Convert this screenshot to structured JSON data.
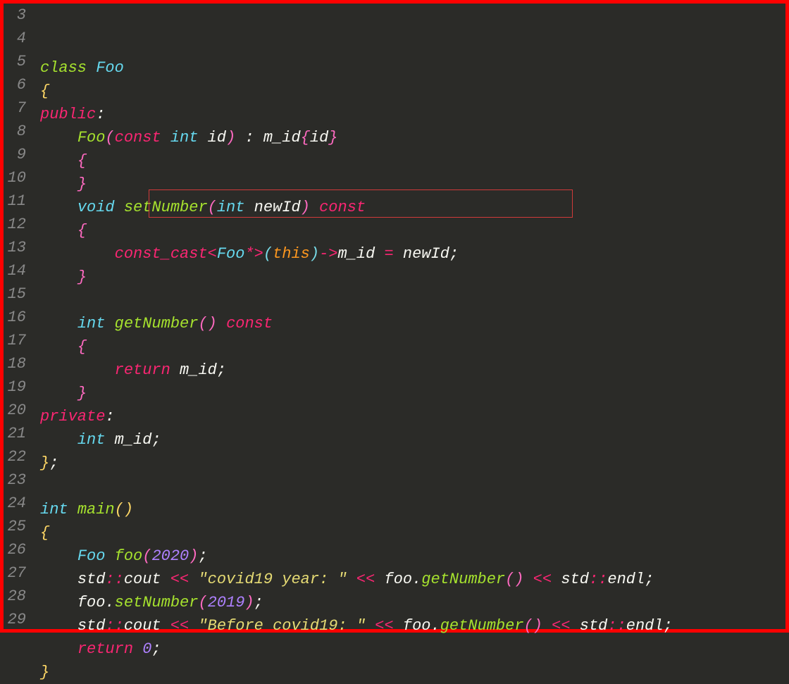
{
  "lines": [
    {
      "num": "3",
      "tokens": [
        [
          "kw-class",
          "class"
        ],
        [
          "punct",
          " "
        ],
        [
          "classname",
          "Foo"
        ]
      ]
    },
    {
      "num": "4",
      "tokens": [
        [
          "brace-y",
          "{"
        ]
      ]
    },
    {
      "num": "5",
      "tokens": [
        [
          "kw-access",
          "public"
        ],
        [
          "punct",
          ":"
        ]
      ]
    },
    {
      "num": "6",
      "tokens": [
        [
          "punct",
          "    "
        ],
        [
          "fn",
          "Foo"
        ],
        [
          "brace-p",
          "("
        ],
        [
          "kw-const",
          "const"
        ],
        [
          "punct",
          " "
        ],
        [
          "kw-type",
          "int"
        ],
        [
          "punct",
          " "
        ],
        [
          "ident",
          "id"
        ],
        [
          "brace-p",
          ")"
        ],
        [
          "punct",
          " : "
        ],
        [
          "ident",
          "m_id"
        ],
        [
          "brace-p",
          "{"
        ],
        [
          "ident",
          "id"
        ],
        [
          "brace-p",
          "}"
        ]
      ]
    },
    {
      "num": "7",
      "tokens": [
        [
          "punct",
          "    "
        ],
        [
          "brace-p",
          "{"
        ]
      ]
    },
    {
      "num": "8",
      "tokens": [
        [
          "punct",
          "    "
        ],
        [
          "brace-p",
          "}"
        ]
      ]
    },
    {
      "num": "9",
      "tokens": [
        [
          "punct",
          "    "
        ],
        [
          "kw-type",
          "void"
        ],
        [
          "punct",
          " "
        ],
        [
          "fn",
          "setNumber"
        ],
        [
          "brace-p",
          "("
        ],
        [
          "kw-type",
          "int"
        ],
        [
          "punct",
          " "
        ],
        [
          "ident",
          "newId"
        ],
        [
          "brace-p",
          ")"
        ],
        [
          "punct",
          " "
        ],
        [
          "kw-const",
          "const"
        ]
      ]
    },
    {
      "num": "10",
      "tokens": [
        [
          "punct",
          "    "
        ],
        [
          "brace-p",
          "{"
        ]
      ]
    },
    {
      "num": "11",
      "tokens": [
        [
          "punct",
          "        "
        ],
        [
          "kw-cast",
          "const_cast"
        ],
        [
          "op",
          "<"
        ],
        [
          "classname",
          "Foo"
        ],
        [
          "op",
          "*>"
        ],
        [
          "brace-b",
          "("
        ],
        [
          "kw-this",
          "this"
        ],
        [
          "brace-b",
          ")"
        ],
        [
          "op",
          "->"
        ],
        [
          "ident",
          "m_id "
        ],
        [
          "op",
          "="
        ],
        [
          "ident",
          " newId"
        ],
        [
          "punct",
          ";"
        ]
      ]
    },
    {
      "num": "12",
      "tokens": [
        [
          "punct",
          "    "
        ],
        [
          "brace-p",
          "}"
        ]
      ]
    },
    {
      "num": "13",
      "tokens": []
    },
    {
      "num": "14",
      "tokens": [
        [
          "punct",
          "    "
        ],
        [
          "kw-type",
          "int"
        ],
        [
          "punct",
          " "
        ],
        [
          "fn",
          "getNumber"
        ],
        [
          "brace-p",
          "()"
        ],
        [
          "punct",
          " "
        ],
        [
          "kw-const",
          "const"
        ]
      ]
    },
    {
      "num": "15",
      "tokens": [
        [
          "punct",
          "    "
        ],
        [
          "brace-p",
          "{"
        ]
      ]
    },
    {
      "num": "16",
      "tokens": [
        [
          "punct",
          "        "
        ],
        [
          "kw-return",
          "return"
        ],
        [
          "punct",
          " "
        ],
        [
          "ident",
          "m_id"
        ],
        [
          "punct",
          ";"
        ]
      ]
    },
    {
      "num": "17",
      "tokens": [
        [
          "punct",
          "    "
        ],
        [
          "brace-p",
          "}"
        ]
      ]
    },
    {
      "num": "18",
      "tokens": [
        [
          "kw-access",
          "private"
        ],
        [
          "punct",
          ":"
        ]
      ]
    },
    {
      "num": "19",
      "tokens": [
        [
          "punct",
          "    "
        ],
        [
          "kw-type",
          "int"
        ],
        [
          "punct",
          " "
        ],
        [
          "ident",
          "m_id"
        ],
        [
          "punct",
          ";"
        ]
      ]
    },
    {
      "num": "20",
      "tokens": [
        [
          "brace-y",
          "}"
        ],
        [
          "punct",
          ";"
        ]
      ]
    },
    {
      "num": "21",
      "tokens": []
    },
    {
      "num": "22",
      "tokens": [
        [
          "kw-type",
          "int"
        ],
        [
          "punct",
          " "
        ],
        [
          "fn",
          "main"
        ],
        [
          "brace-y",
          "()"
        ]
      ]
    },
    {
      "num": "23",
      "tokens": [
        [
          "brace-y",
          "{"
        ]
      ]
    },
    {
      "num": "24",
      "tokens": [
        [
          "punct",
          "    "
        ],
        [
          "classname",
          "Foo"
        ],
        [
          "punct",
          " "
        ],
        [
          "fn",
          "foo"
        ],
        [
          "brace-p",
          "("
        ],
        [
          "num",
          "2020"
        ],
        [
          "brace-p",
          ")"
        ],
        [
          "punct",
          ";"
        ]
      ]
    },
    {
      "num": "25",
      "tokens": [
        [
          "punct",
          "    "
        ],
        [
          "ident",
          "std"
        ],
        [
          "op",
          "::"
        ],
        [
          "ident",
          "cout "
        ],
        [
          "op",
          "<<"
        ],
        [
          "punct",
          " "
        ],
        [
          "str",
          "\"covid19 year: \""
        ],
        [
          "punct",
          " "
        ],
        [
          "op",
          "<<"
        ],
        [
          "punct",
          " "
        ],
        [
          "ident",
          "foo"
        ],
        [
          "punct",
          "."
        ],
        [
          "fn",
          "getNumber"
        ],
        [
          "brace-p",
          "()"
        ],
        [
          "punct",
          " "
        ],
        [
          "op",
          "<<"
        ],
        [
          "punct",
          " "
        ],
        [
          "ident",
          "std"
        ],
        [
          "op",
          "::"
        ],
        [
          "ident",
          "endl"
        ],
        [
          "punct",
          ";"
        ]
      ]
    },
    {
      "num": "26",
      "tokens": [
        [
          "punct",
          "    "
        ],
        [
          "ident",
          "foo"
        ],
        [
          "punct",
          "."
        ],
        [
          "fn",
          "setNumber"
        ],
        [
          "brace-p",
          "("
        ],
        [
          "num",
          "2019"
        ],
        [
          "brace-p",
          ")"
        ],
        [
          "punct",
          ";"
        ]
      ]
    },
    {
      "num": "27",
      "tokens": [
        [
          "punct",
          "    "
        ],
        [
          "ident",
          "std"
        ],
        [
          "op",
          "::"
        ],
        [
          "ident",
          "cout "
        ],
        [
          "op",
          "<<"
        ],
        [
          "punct",
          " "
        ],
        [
          "str",
          "\"Before covid19: \""
        ],
        [
          "punct",
          " "
        ],
        [
          "op",
          "<<"
        ],
        [
          "punct",
          " "
        ],
        [
          "ident",
          "foo"
        ],
        [
          "punct",
          "."
        ],
        [
          "fn",
          "getNumber"
        ],
        [
          "brace-p",
          "()"
        ],
        [
          "punct",
          " "
        ],
        [
          "op",
          "<<"
        ],
        [
          "punct",
          " "
        ],
        [
          "ident",
          "std"
        ],
        [
          "op",
          "::"
        ],
        [
          "ident",
          "endl"
        ],
        [
          "punct",
          ";"
        ]
      ]
    },
    {
      "num": "28",
      "tokens": [
        [
          "punct",
          "    "
        ],
        [
          "kw-return",
          "return"
        ],
        [
          "punct",
          " "
        ],
        [
          "num",
          "0"
        ],
        [
          "punct",
          ";"
        ]
      ]
    },
    {
      "num": "29",
      "tokens": [
        [
          "brace-y",
          "}"
        ]
      ]
    }
  ]
}
